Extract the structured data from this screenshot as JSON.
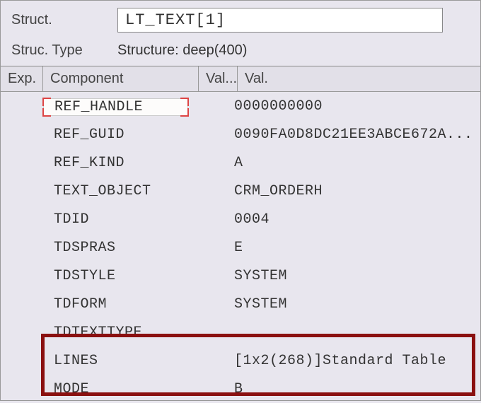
{
  "header": {
    "struct_label": "Struct.",
    "struct_value": "LT_TEXT[1]",
    "type_label": "Struc. Type",
    "type_value": "Structure: deep(400)"
  },
  "columns": {
    "exp": "Exp.",
    "component": "Component",
    "val1": "Val...",
    "val2": "Val."
  },
  "rows": [
    {
      "component": "REF_HANDLE",
      "value": "0000000000",
      "input": true
    },
    {
      "component": "REF_GUID",
      "value": "0090FA0D8DC21EE3ABCE672A..."
    },
    {
      "component": "REF_KIND",
      "value": "A"
    },
    {
      "component": "TEXT_OBJECT",
      "value": "CRM_ORDERH"
    },
    {
      "component": "TDID",
      "value": "0004"
    },
    {
      "component": "TDSPRAS",
      "value": "E"
    },
    {
      "component": "TDSTYLE",
      "value": "SYSTEM"
    },
    {
      "component": "TDFORM",
      "value": "SYSTEM"
    },
    {
      "component": "TDTEXTTYPE",
      "value": ""
    },
    {
      "component": "LINES",
      "value": "[1x2(268)]Standard Table"
    },
    {
      "component": "MODE",
      "value": "B"
    }
  ]
}
